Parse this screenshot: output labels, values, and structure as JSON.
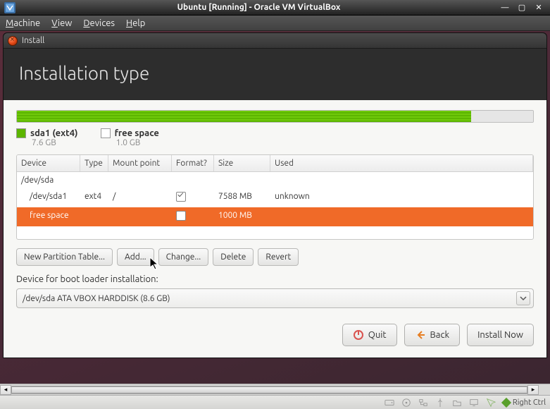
{
  "host_window": {
    "title": "Ubuntu [Running] - Oracle VM VirtualBox",
    "min_symbol": "—",
    "max_symbol": "▢",
    "close_symbol": "✕"
  },
  "host_menubar": {
    "items": [
      "Machine",
      "View",
      "Devices",
      "Help"
    ]
  },
  "install_window": {
    "title": "Install"
  },
  "header": {
    "title": "Installation type"
  },
  "diskbar": {
    "used_percent": 88,
    "free_percent": 12
  },
  "legend": {
    "used": {
      "label": "sda1 (ext4)",
      "size": "7.6 GB"
    },
    "free": {
      "label": "free space",
      "size": "1.0 GB"
    }
  },
  "table": {
    "columns": [
      "Device",
      "Type",
      "Mount point",
      "Format?",
      "Size",
      "Used"
    ],
    "rows": [
      {
        "kind": "parent",
        "device": "/dev/sda",
        "type": "",
        "mount": "",
        "format": null,
        "size": "",
        "used": ""
      },
      {
        "kind": "child",
        "selected": false,
        "device": "/dev/sda1",
        "type": "ext4",
        "mount": "/",
        "format": true,
        "size": "7588 MB",
        "used": "unknown"
      },
      {
        "kind": "child",
        "selected": true,
        "device": "free space",
        "type": "",
        "mount": "",
        "format": false,
        "size": "1000 MB",
        "used": ""
      }
    ]
  },
  "buttons": {
    "new_table": "New Partition Table...",
    "add": "Add...",
    "change": "Change...",
    "delete": "Delete",
    "revert": "Revert"
  },
  "bootloader": {
    "label": "Device for boot loader installation:",
    "value": "/dev/sda   ATA VBOX HARDDISK (8.6 GB)"
  },
  "footer": {
    "quit": "Quit",
    "back": "Back",
    "install": "Install Now"
  },
  "statusbar": {
    "hostkey": "Right Ctrl"
  }
}
